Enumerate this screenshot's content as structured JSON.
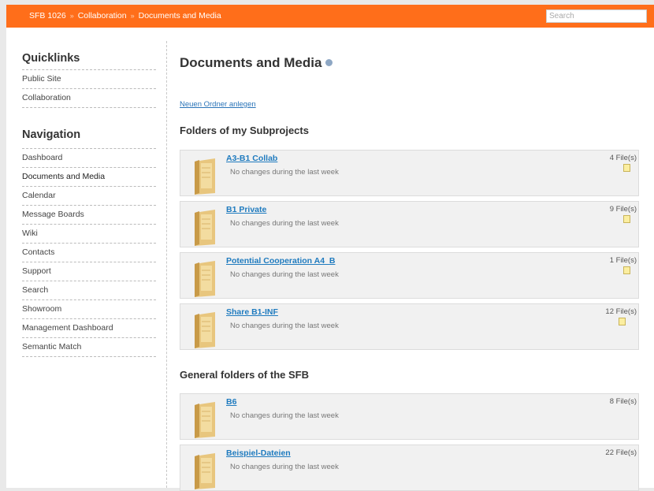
{
  "breadcrumb": {
    "items": [
      "SFB 1026",
      "Collaboration",
      "Documents and Media"
    ],
    "separator": "»"
  },
  "search": {
    "placeholder": "Search"
  },
  "sidebar": {
    "quicklinks_title": "Quicklinks",
    "quicklinks": [
      "Public Site",
      "Collaboration"
    ],
    "navigation_title": "Navigation",
    "navigation": [
      "Dashboard",
      "Documents and Media",
      "Calendar",
      "Message Boards",
      "Wiki",
      "Contacts",
      "Support",
      "Search",
      "Showroom",
      "Management Dashboard",
      "Semantic Match"
    ]
  },
  "main": {
    "title": "Documents and Media",
    "new_folder_link": "Neuen Ordner anlegen",
    "subprojects_title": "Folders of my Subprojects",
    "subprojects": [
      {
        "name": "A3-B1 Collab",
        "desc": "No changes during the last week",
        "count": "4 File(s)"
      },
      {
        "name": "B1 Private",
        "desc": "No changes during the last week",
        "count": "9 File(s)"
      },
      {
        "name": "Potential Cooperation A4_B",
        "desc": "No changes during the last week",
        "count": "1 File(s)"
      },
      {
        "name": "Share B1-INF",
        "desc": "No changes during the last week",
        "count": "12 File(s)"
      }
    ],
    "general_title": "General folders of the SFB",
    "general": [
      {
        "name": "B6",
        "desc": "No changes during the last week",
        "count": "8 File(s)"
      },
      {
        "name": "Beispiel-Dateien",
        "desc": "No changes during the last week",
        "count": "22 File(s)"
      }
    ]
  },
  "colors": {
    "accent": "#ff6e1a",
    "link": "#1f7bbf",
    "row_bg": "#f1f1f1"
  },
  "icons": {
    "folder": "folder-icon",
    "note": "note-icon",
    "help": "help-icon"
  }
}
